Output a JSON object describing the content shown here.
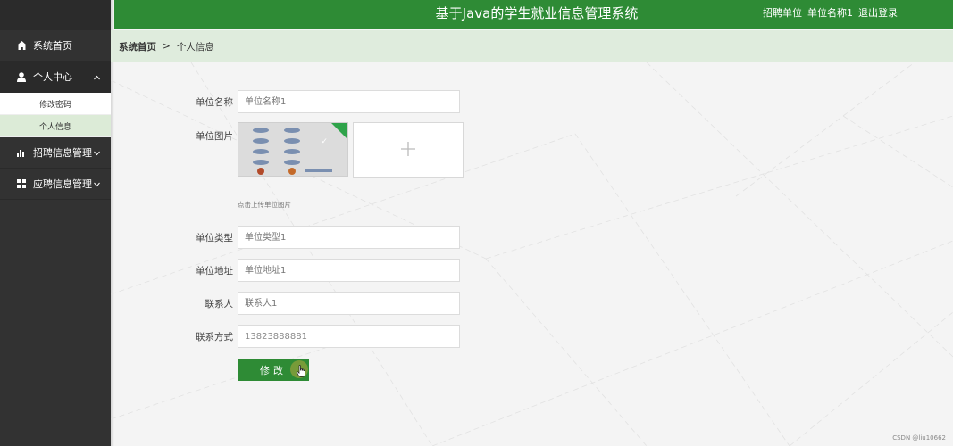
{
  "header": {
    "title": "基于Java的学生就业信息管理系统",
    "user_role": "招聘单位",
    "user_name": "单位名称1",
    "logout_label": "退出登录"
  },
  "sidebar": {
    "items": [
      {
        "label": "系统首页",
        "icon": "home-icon"
      },
      {
        "label": "个人中心",
        "icon": "user-icon",
        "expanded": true,
        "children": [
          {
            "label": "修改密码"
          },
          {
            "label": "个人信息",
            "active": true
          }
        ]
      },
      {
        "label": "招聘信息管理",
        "icon": "bar-chart-icon"
      },
      {
        "label": "应聘信息管理",
        "icon": "grid-icon"
      }
    ]
  },
  "breadcrumb": {
    "home": "系统首页",
    "separator": ">",
    "current": "个人信息"
  },
  "form": {
    "company_name": {
      "label": "单位名称",
      "placeholder": "单位名称1"
    },
    "company_image": {
      "label": "单位图片",
      "hint": "点击上传单位图片"
    },
    "company_type": {
      "label": "单位类型",
      "placeholder": "单位类型1"
    },
    "company_address": {
      "label": "单位地址",
      "placeholder": "单位地址1"
    },
    "contact_person": {
      "label": "联系人",
      "placeholder": "联系人1"
    },
    "contact_phone": {
      "label": "联系方式",
      "value": "13823888881"
    },
    "submit_label": "修改"
  },
  "watermark": "CSDN @liu10662",
  "colors": {
    "primary": "#2e8b35",
    "sidebar_bg": "#323232",
    "breadcrumb_bg": "#dfecdd"
  }
}
